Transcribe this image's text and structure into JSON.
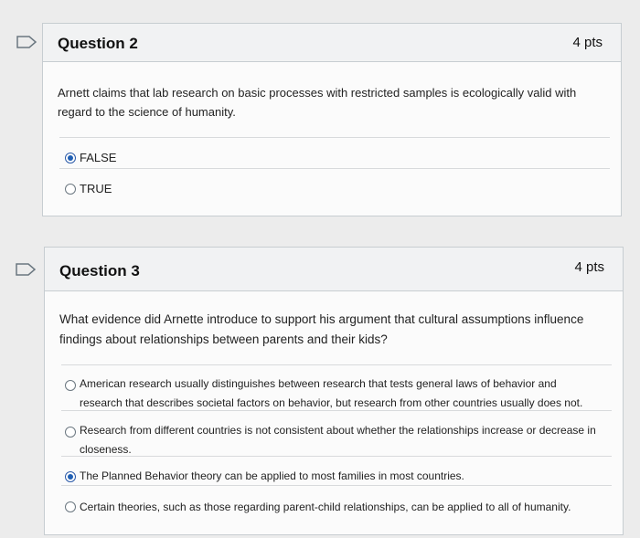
{
  "questions": [
    {
      "title": "Question 2",
      "points": "4 pts",
      "text": "Arnett claims that lab research on basic processes with restricted samples is ecologically valid with regard to the science of humanity.",
      "answers": [
        {
          "label": "FALSE",
          "selected": true
        },
        {
          "label": "TRUE",
          "selected": false
        }
      ]
    },
    {
      "title": "Question 3",
      "points": "4 pts",
      "text": "What evidence did Arnette introduce to support his argument that cultural assumptions influence findings about relationships between parents and their kids?",
      "answers": [
        {
          "label": "American research usually distinguishes between research that tests general laws of behavior and research that describes societal factors on behavior, but research from other countries usually does not.",
          "selected": false
        },
        {
          "label": "Research from different countries is not consistent about whether the relationships increase or decrease in closeness.",
          "selected": false
        },
        {
          "label": "The Planned Behavior theory can be applied to most families in most countries.",
          "selected": true
        },
        {
          "label": "Certain theories, such as those regarding parent-child relationships, can be applied to all of humanity.",
          "selected": false
        }
      ]
    }
  ],
  "icons": {
    "flag": "flag-question-icon",
    "radio": "radio-button-icon"
  },
  "colors": {
    "selected_radio": "#1f5fb4",
    "border": "#c7cdd1"
  }
}
